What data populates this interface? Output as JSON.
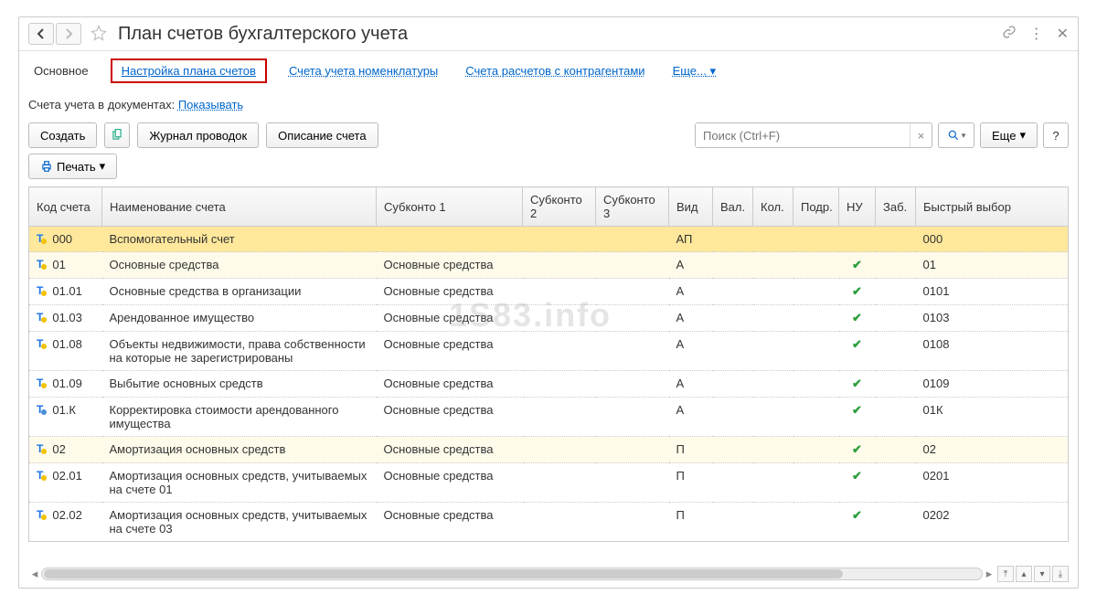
{
  "title": "План счетов бухгалтерского учета",
  "tabs": {
    "main": "Основное",
    "settings": "Настройка плана счетов",
    "nomenclature": "Счета учета номенклатуры",
    "counterparties": "Счета расчетов с контрагентами",
    "more": "Еще..."
  },
  "info": {
    "label": "Счета учета в документах:",
    "link": "Показывать"
  },
  "toolbar": {
    "create": "Создать",
    "journal": "Журнал проводок",
    "description": "Описание счета",
    "search_placeholder": "Поиск (Ctrl+F)",
    "more": "Еще",
    "print": "Печать"
  },
  "columns": {
    "code": "Код счета",
    "name": "Наименование счета",
    "sub1": "Субконто 1",
    "sub2": "Субконто 2",
    "sub3": "Субконто 3",
    "kind": "Вид",
    "val": "Вал.",
    "kol": "Кол.",
    "podr": "Подр.",
    "nu": "НУ",
    "zab": "Заб.",
    "quick": "Быстрый выбор"
  },
  "rows": [
    {
      "code": "000",
      "name": "Вспомогательный счет",
      "sub1": "",
      "kind": "АП",
      "nu": false,
      "quick": "000",
      "dot": "y",
      "sel": "deep"
    },
    {
      "code": "01",
      "name": "Основные средства",
      "sub1": "Основные средства",
      "kind": "А",
      "nu": true,
      "quick": "01",
      "dot": "y",
      "sel": "hl"
    },
    {
      "code": "01.01",
      "name": "Основные средства в организации",
      "sub1": "Основные средства",
      "kind": "А",
      "nu": true,
      "quick": "0101",
      "dot": "y"
    },
    {
      "code": "01.03",
      "name": "Арендованное имущество",
      "sub1": "Основные средства",
      "kind": "А",
      "nu": true,
      "quick": "0103",
      "dot": "y"
    },
    {
      "code": "01.08",
      "name": "Объекты недвижимости, права собственности на которые не зарегистрированы",
      "sub1": "Основные средства",
      "kind": "А",
      "nu": true,
      "quick": "0108",
      "dot": "y"
    },
    {
      "code": "01.09",
      "name": "Выбытие основных средств",
      "sub1": "Основные средства",
      "kind": "А",
      "nu": true,
      "quick": "0109",
      "dot": "y"
    },
    {
      "code": "01.К",
      "name": "Корректировка стоимости арендованного имущества",
      "sub1": "Основные средства",
      "kind": "А",
      "nu": true,
      "quick": "01К",
      "dot": "b"
    },
    {
      "code": "02",
      "name": "Амортизация основных средств",
      "sub1": "Основные средства",
      "kind": "П",
      "nu": true,
      "quick": "02",
      "dot": "y",
      "sel": "hl"
    },
    {
      "code": "02.01",
      "name": "Амортизация основных средств, учитываемых на счете 01",
      "sub1": "Основные средства",
      "kind": "П",
      "nu": true,
      "quick": "0201",
      "dot": "y"
    },
    {
      "code": "02.02",
      "name": "Амортизация основных средств, учитываемых на счете 03",
      "sub1": "Основные средства",
      "kind": "П",
      "nu": true,
      "quick": "0202",
      "dot": "y"
    }
  ],
  "watermark": "1S83.info"
}
